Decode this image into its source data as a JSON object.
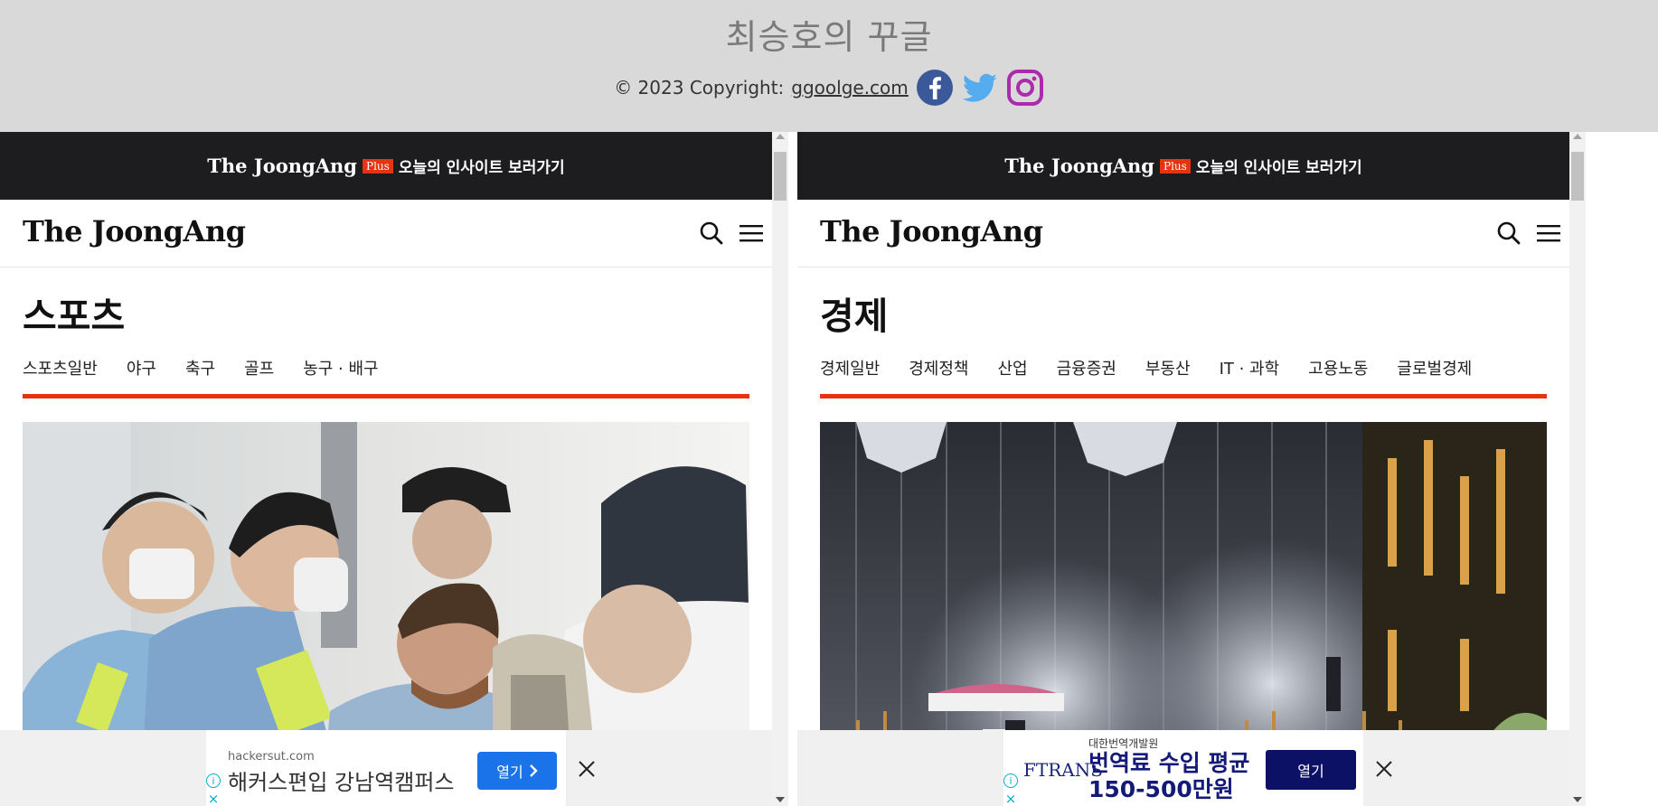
{
  "header": {
    "title": "최승호의 꾸글",
    "copyright": "© 2023 Copyright:",
    "link": "ggoolge.com",
    "social": [
      "facebook-icon",
      "twitter-icon",
      "instagram-icon"
    ]
  },
  "colors": {
    "facebook": "#3b5998",
    "twitter": "#55acee",
    "instagram": "#ac2bac",
    "accent_red": "#e63312",
    "promo_bg": "#1d1d20"
  },
  "frames": [
    {
      "promo": {
        "brand": "The JoongAng",
        "badge": "Plus",
        "text": "오늘의 인사이트 보러가기"
      },
      "logo": "The JoongAng",
      "section": "스포츠",
      "subnav": [
        "스포츠일반",
        "야구",
        "축구",
        "골프",
        "농구 · 배구"
      ],
      "ad": {
        "domain": "hackersut.com",
        "headline": "해커스편입 강남역캠퍼스",
        "button": "열기"
      }
    },
    {
      "promo": {
        "brand": "The JoongAng",
        "badge": "Plus",
        "text": "오늘의 인사이트 보러가기"
      },
      "logo": "The JoongAng",
      "section": "경제",
      "subnav": [
        "경제일반",
        "경제정책",
        "산업",
        "금융증권",
        "부동산",
        "IT · 과학",
        "고용노동",
        "글로벌경제"
      ],
      "ad": {
        "small": "대한번역개발원",
        "brand": "FTRANS",
        "headline_line1": "번역료 수입 평균",
        "headline_line2": "150-500만원",
        "button": "열기"
      }
    }
  ]
}
